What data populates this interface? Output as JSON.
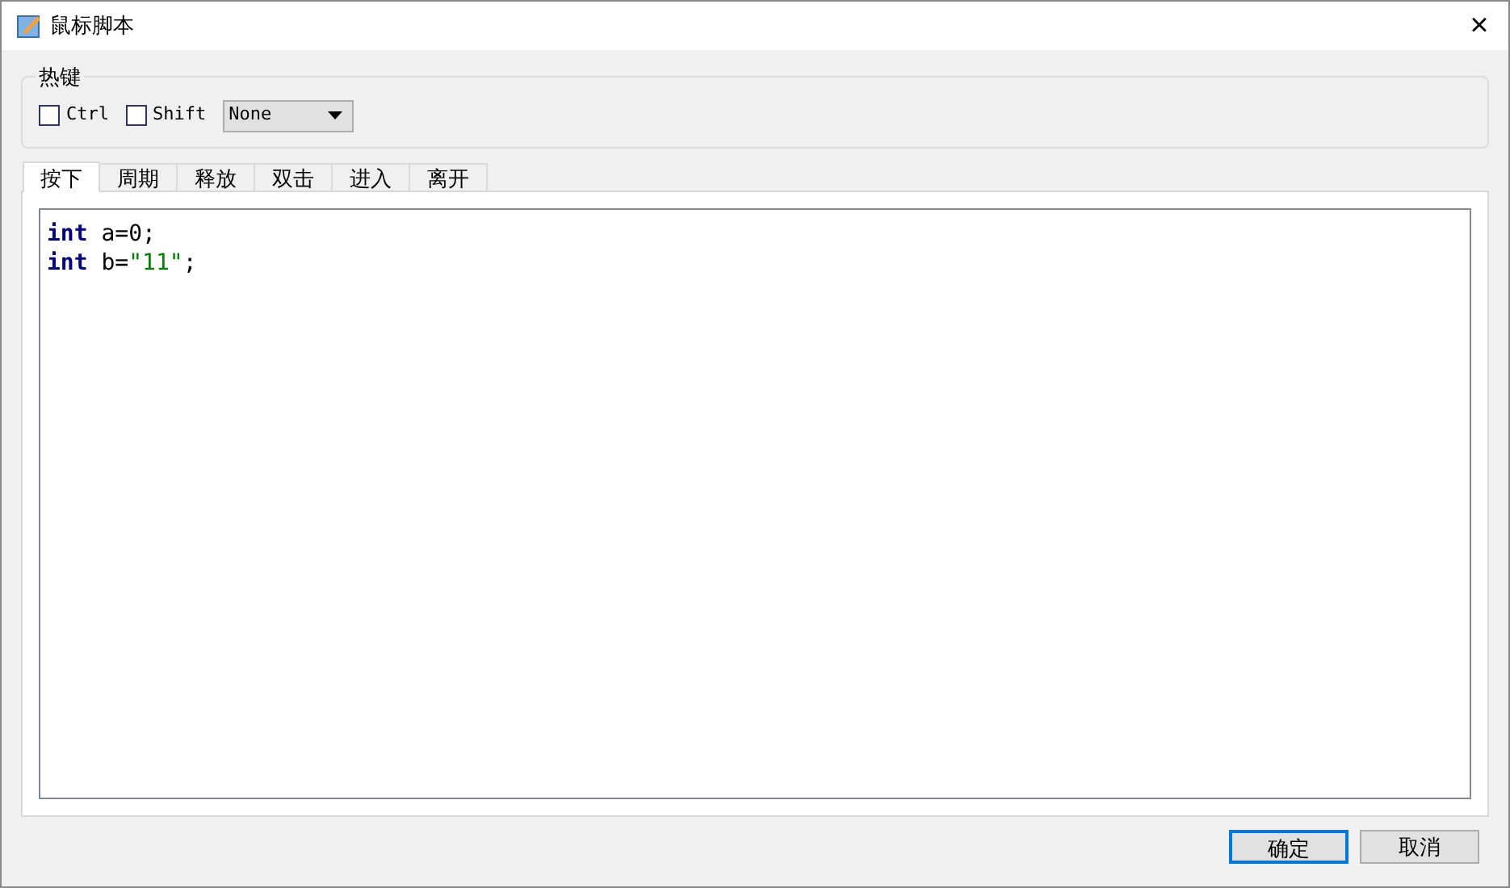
{
  "window": {
    "title": "鼠标脚本",
    "close": "×"
  },
  "hotkey": {
    "title": "热键",
    "modifiers": [
      {
        "label": "Ctrl",
        "checked": false
      },
      {
        "label": "Shift",
        "checked": false
      }
    ],
    "key": {
      "value": "None"
    }
  },
  "tabs": [
    {
      "label": "按下",
      "selected": true
    },
    {
      "label": "周期",
      "selected": false
    },
    {
      "label": "释放",
      "selected": false
    },
    {
      "label": "双击",
      "selected": false
    },
    {
      "label": "进入",
      "selected": false
    },
    {
      "label": "离开",
      "selected": false
    }
  ],
  "editor": {
    "lines": [
      [
        {
          "kind": "keyword",
          "text": "int"
        },
        {
          "kind": "plain",
          "text": " a=0;"
        }
      ],
      [
        {
          "kind": "keyword",
          "text": "int"
        },
        {
          "kind": "plain",
          "text": " b="
        },
        {
          "kind": "string",
          "text": "\"11\""
        },
        {
          "kind": "plain",
          "text": ";"
        }
      ]
    ]
  },
  "buttons": [
    {
      "label": "确定",
      "kind": "default"
    },
    {
      "label": "取消",
      "kind": "normal"
    }
  ]
}
